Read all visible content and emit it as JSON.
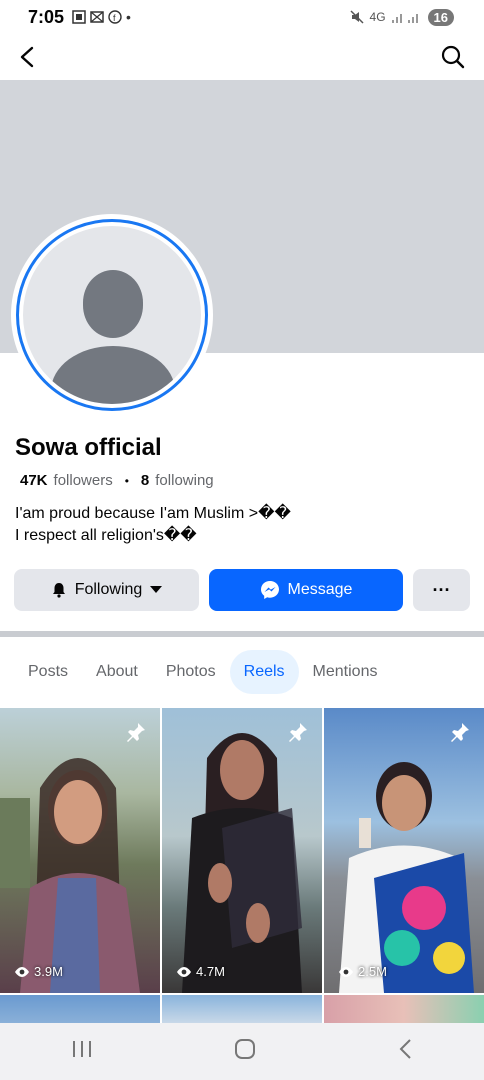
{
  "status_bar": {
    "time": "7:05",
    "network": "4G",
    "battery": "16"
  },
  "profile": {
    "name": "Sowa official",
    "followers_count": "47K",
    "followers_label": "followers",
    "separator": "•",
    "following_count": "8",
    "following_label": "following",
    "bio_line1": "I'am proud because  I'am Muslim >��",
    "bio_line2": "I respect all religion's��"
  },
  "actions": {
    "following_label": "Following",
    "message_label": "Message",
    "more_label": "···"
  },
  "tabs": [
    {
      "label": "Posts",
      "active": false
    },
    {
      "label": "About",
      "active": false
    },
    {
      "label": "Photos",
      "active": false
    },
    {
      "label": "Reels",
      "active": true
    },
    {
      "label": "Mentions",
      "active": false
    }
  ],
  "reels": [
    {
      "views": "3.9M",
      "pinned": true
    },
    {
      "views": "4.7M",
      "pinned": true
    },
    {
      "views": "2.5M",
      "pinned": true
    }
  ],
  "colors": {
    "accent": "#0866ff",
    "ring": "#1977f2",
    "cover": "#d2d5da"
  }
}
